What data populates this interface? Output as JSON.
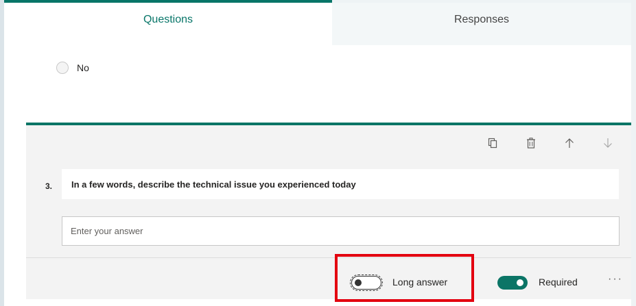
{
  "tabs": [
    {
      "label": "Questions",
      "active": true
    },
    {
      "label": "Responses",
      "active": false
    }
  ],
  "previous_question": {
    "option_label": "No"
  },
  "question": {
    "number": "3.",
    "title": "In a few words, describe the technical issue you experienced today",
    "answer_placeholder": "Enter your answer",
    "toolbar_icons": [
      "copy-icon",
      "delete-icon",
      "move-up-icon",
      "move-down-icon"
    ]
  },
  "footer": {
    "long_answer_label": "Long answer",
    "long_answer_on": false,
    "required_label": "Required",
    "required_on": true,
    "more_label": "···"
  },
  "colors": {
    "accent": "#077568",
    "highlight": "#e3000f",
    "panel_bg": "#f3f3f3"
  }
}
